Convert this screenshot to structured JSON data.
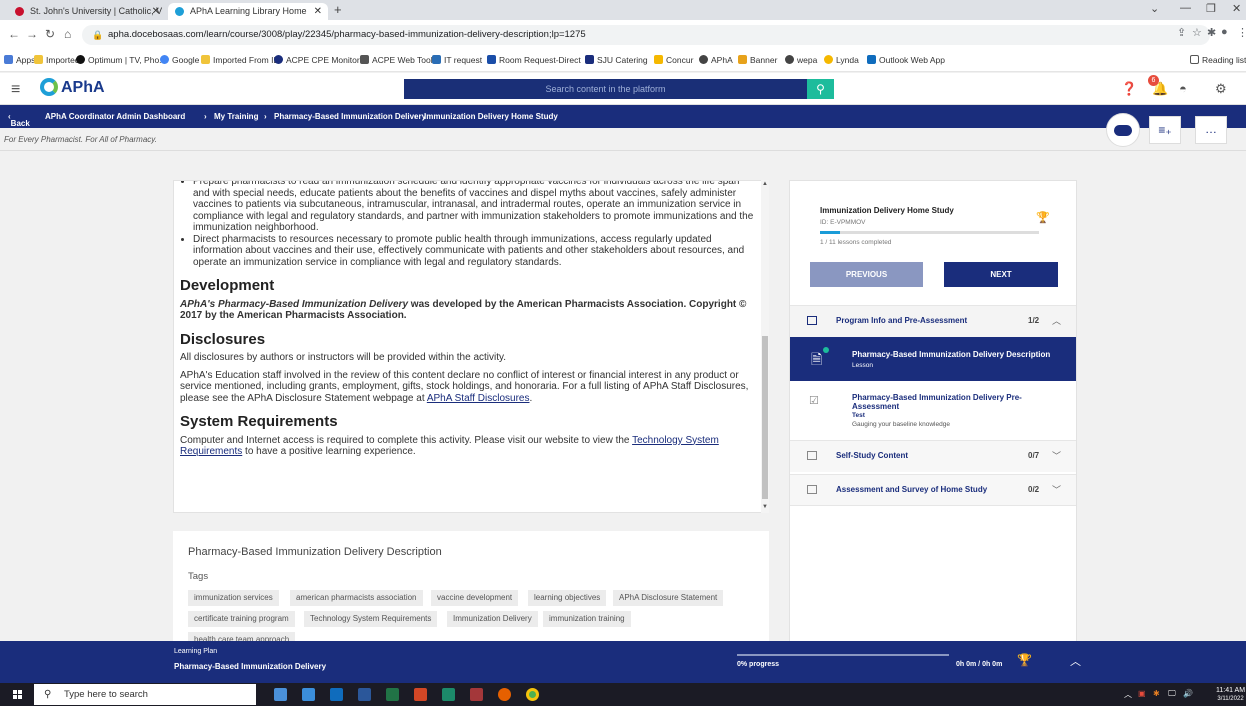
{
  "browser": {
    "tabs": [
      {
        "title": "St. John's University | Catholic, V",
        "active": false
      },
      {
        "title": "APhA Learning Library Home",
        "active": true
      }
    ],
    "url": "apha.docebosaas.com/learn/course/3008/play/22345/pharmacy-based-immunization-delivery-description;lp=1275",
    "bookmarks": [
      "Apps",
      "Imported",
      "Optimum | TV, Pho...",
      "Google",
      "Imported From IE",
      "ACPE CPE Monitor",
      "ACPE Web Tool",
      "IT request",
      "Room Request-Direct",
      "SJU Catering",
      "Concur",
      "APhA",
      "Banner",
      "wepa",
      "Lynda",
      "Outlook Web App"
    ],
    "reading_list": "Reading list"
  },
  "header": {
    "logo": "APhA",
    "search_placeholder": "Search content in the platform",
    "notification_count": "6"
  },
  "breadcrumb": {
    "back": "Back",
    "items": [
      "APhA Coordinator Admin Dashboard",
      "My Training",
      "Pharmacy-Based Immunization Delivery",
      "Immunization Delivery Home Study"
    ]
  },
  "tagline": "For Every Pharmacist. For All of Pharmacy.",
  "content": {
    "bullet1": "Prepare pharmacists to read an immunization schedule and identify appropriate vaccines for individuals across the life span and with special needs, educate patients about the benefits of vaccines and dispel myths about vaccines, safely administer vaccines to patients via subcutaneous, intramuscular, intranasal, and intradermal routes, operate an immunization service in compliance with legal and regulatory standards, and partner with immunization stakeholders to promote immunizations and the immunization neighborhood.",
    "bullet2": "Direct pharmacists to resources necessary to promote public health through immunizations, access regularly updated information about vaccines and their use, effectively communicate with patients and other stakeholders about resources, and operate an immunization service in compliance with legal and regulatory standards.",
    "development_heading": "Development",
    "development_italic": "APhA's Pharmacy-Based Immunization Delivery",
    "development_text": " was developed by the American Pharmacists Association. Copyright © 2017 by the American Pharmacists Association.",
    "disclosures_heading": "Disclosures",
    "disclosures_p1": "All disclosures by authors or instructors will be provided within the activity.",
    "disclosures_p2": "APhA's Education staff involved in the review of this content declare no conflict of interest or financial interest in any product or service mentioned, including grants, employment, gifts, stock holdings, and honoraria. For a full listing of APhA Staff Disclosures, please see the APhA Disclosure Statement webpage at ",
    "disclosures_link": "APhA Staff Disclosures",
    "sysreq_heading": "System Requirements",
    "sysreq_text": "Computer and Internet access is required to complete this activity.  Please visit our website to view the ",
    "sysreq_link": "Technology System Requirements",
    "sysreq_tail": " to have a positive learning experience."
  },
  "description": {
    "title": "Pharmacy-Based Immunization Delivery Description",
    "tags_label": "Tags",
    "tags": [
      "immunization services",
      "american pharmacists association",
      "vaccine development",
      "learning objectives",
      "APhA Disclosure Statement",
      "certificate training program",
      "Technology System Requirements",
      "Immunization Delivery",
      "immunization training",
      "health care team approach"
    ]
  },
  "course": {
    "title": "Immunization Delivery Home Study",
    "id": "ID: E-VPMMOV",
    "lessons_completed": "1 / 11 lessons completed",
    "progress_fraction": 0.09,
    "previous": "PREVIOUS",
    "next": "NEXT",
    "sections": [
      {
        "label": "Program Info and Pre-Assessment",
        "count": "1/2",
        "chevron": "^"
      },
      {
        "label": "Self-Study Content",
        "count": "0/7",
        "chevron": "v"
      },
      {
        "label": "Assessment and Survey of Home Study",
        "count": "0/2",
        "chevron": "v"
      }
    ],
    "lessons": [
      {
        "title": "Pharmacy-Based Immunization Delivery Description",
        "type": "Lesson"
      },
      {
        "title": "Pharmacy-Based Immunization Delivery Pre-Assessment",
        "type": "Test",
        "desc": "Gauging your baseline knowledge"
      }
    ]
  },
  "learning_plan": {
    "label": "Learning Plan",
    "title": "Pharmacy-Based Immunization Delivery",
    "progress": "0% progress",
    "time": "0h 0m / 0h 0m"
  },
  "taskbar": {
    "search_placeholder": "Type here to search",
    "time": "11:41 AM",
    "date": "3/11/2022"
  }
}
